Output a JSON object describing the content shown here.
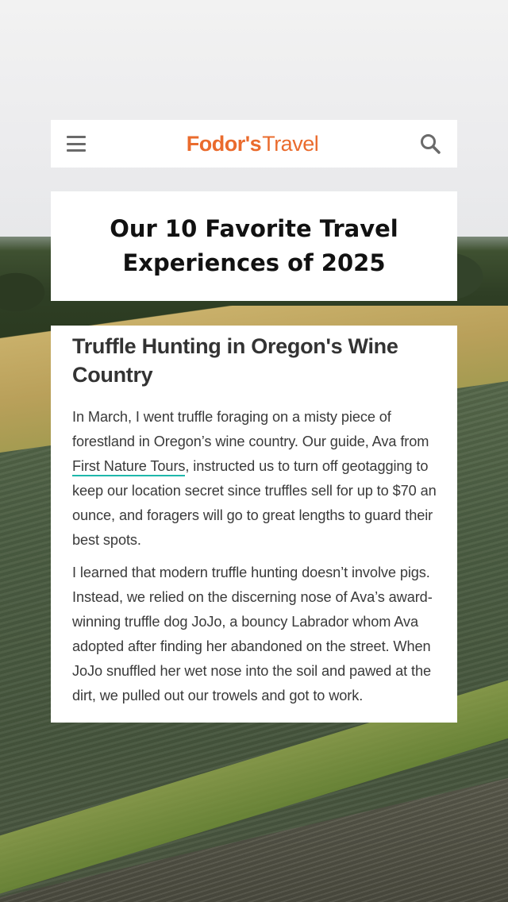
{
  "header": {
    "logo_brand": "Fodor's",
    "logo_sub": "Travel",
    "brand_color": "#ea6b2d",
    "menu_icon": "hamburger-menu-icon",
    "search_icon": "search-icon"
  },
  "title_card": {
    "title": "Our 10 Favorite Travel Experiences of 2025"
  },
  "article": {
    "heading": "Truffle Hunting in Oregon's Wine Country",
    "p1_before": "In March, I went truffle foraging on a misty piece of forestland in Oregon’s wine country. Our guide, Ava from ",
    "p1_link": "First Nature Tours",
    "p1_after": ", instructed us to turn off geotagging to keep our location secret since truffles sell for up to $70 an ounce, and foragers will go to great lengths to guard their best spots.",
    "p2": "I learned that modern truffle hunting doesn’t involve pigs. Instead, we relied on the discerning nose of Ava’s award-winning truffle dog JoJo, a bouncy Labrador whom Ava adopted after finding her abandoned on the street. When JoJo snuffled her wet nose into the soil and pawed at the dirt, we pulled out our trowels and got to work.",
    "link_underline_color": "#1eb7ab"
  }
}
